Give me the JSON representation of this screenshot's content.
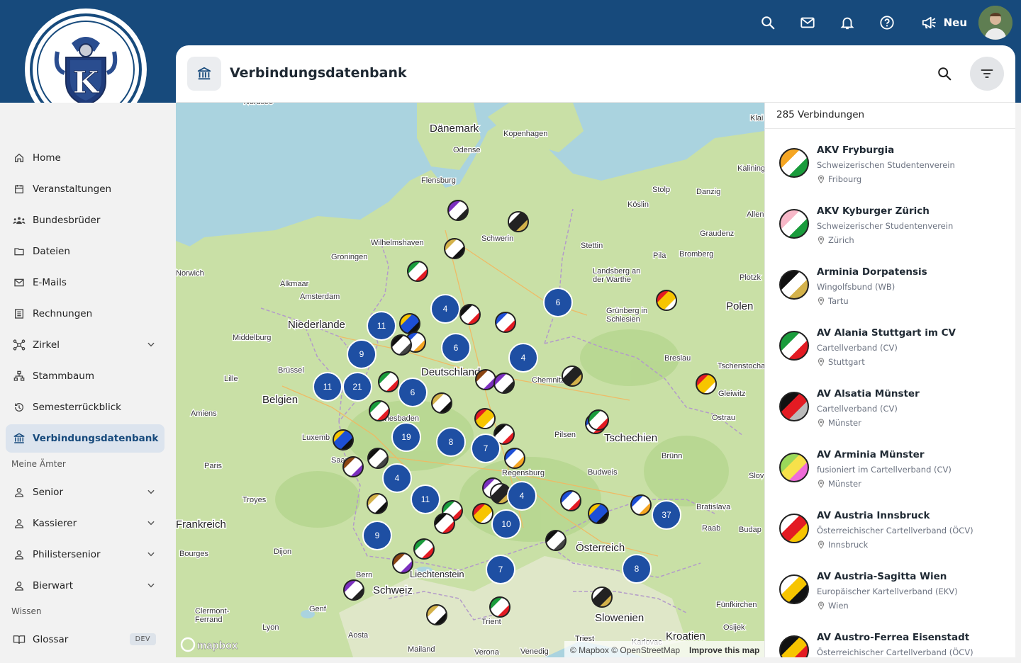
{
  "header": {
    "new_label": "Neu",
    "icons": [
      "search-icon",
      "mail-icon",
      "bell-icon",
      "help-icon",
      "megaphone-icon"
    ]
  },
  "sidebar": {
    "items": [
      {
        "label": "Home",
        "icon": "home-icon"
      },
      {
        "label": "Veranstaltungen",
        "icon": "calendar-icon"
      },
      {
        "label": "Bundesbrüder",
        "icon": "group-icon"
      },
      {
        "label": "Dateien",
        "icon": "folder-icon"
      },
      {
        "label": "E-Mails",
        "icon": "mail-icon"
      },
      {
        "label": "Rechnungen",
        "icon": "receipt-icon"
      },
      {
        "label": "Zirkel",
        "icon": "network-icon"
      },
      {
        "label": "Stammbaum",
        "icon": "tree-icon"
      },
      {
        "label": "Semesterrückblick",
        "icon": "history-icon"
      },
      {
        "label": "Verbindungsdatenbank",
        "icon": "bank-icon",
        "active": true
      }
    ],
    "section_offices": "Meine Ämter",
    "offices": [
      {
        "label": "Senior"
      },
      {
        "label": "Kassierer"
      },
      {
        "label": "Philistersenior"
      },
      {
        "label": "Bierwart"
      }
    ],
    "section_knowledge": "Wissen",
    "knowledge": [
      {
        "label": "Glossar",
        "badge": "DEV"
      }
    ]
  },
  "page": {
    "title": "Verbindungsdatenbank"
  },
  "map": {
    "attribution": "© Mapbox © OpenStreetMap",
    "improve": "Improve this map",
    "mapbox_logo": "mapbox",
    "countries": [
      {
        "name": "Dänemark"
      },
      {
        "name": "Niederlande"
      },
      {
        "name": "Belgien"
      },
      {
        "name": "Deutschland"
      },
      {
        "name": "Tschechien"
      },
      {
        "name": "Polen"
      },
      {
        "name": "Frankreich"
      },
      {
        "name": "Schweiz"
      },
      {
        "name": "Liechtenstein"
      },
      {
        "name": "Österreich"
      },
      {
        "name": "Slowenien"
      },
      {
        "name": "Kroatien"
      }
    ],
    "cities": [
      "Kopenhagen",
      "Odense",
      "Flensburg",
      "Schwerin",
      "Wilhelmshaven",
      "Groningen",
      "Norwich",
      "Alkmaar",
      "Amsterdam",
      "Middelburg",
      "Brüssel",
      "Lille",
      "Amiens",
      "Paris",
      "Troyes",
      "Luxemb",
      "Bourges",
      "Dijon",
      "Clermont-Ferrand",
      "Lyon",
      "Genf",
      "Bern",
      "Aosta",
      "Mailand",
      "Verona",
      "Venedig",
      "Trient",
      "Triest",
      "Stettin",
      "Stolp",
      "Danzig",
      "Köslin",
      "Graudenz",
      "Bromberg",
      "Pila",
      "Landsberg an der Warthe",
      "Grünberg in Schlesien",
      "Breslau",
      "Plotzk",
      "Tschenstocha",
      "Gleiwitz",
      "Ostrau",
      "Chemnitz",
      "Pilsen",
      "Regensburg",
      "Budweis",
      "Brünn",
      "Bratislava",
      "Raab",
      "Budap",
      "Fünfkirchen",
      "Osijek",
      "Karlovac",
      "Kaliningr",
      "Allen",
      "Klai",
      "Slov",
      "Saar",
      "Wiesbaden",
      "Nordsee"
    ],
    "clusters": [
      4,
      6,
      11,
      9,
      6,
      4,
      11,
      21,
      6,
      19,
      8,
      7,
      4,
      11,
      4,
      10,
      9,
      37,
      7,
      8
    ]
  },
  "list": {
    "count": "285 Verbindungen",
    "items": [
      {
        "name": "AKV Fryburgia",
        "sub": "Schweizerischen Studentenverein",
        "loc": "Fribourg",
        "colors": [
          "#1a9c3c",
          "#ffffff",
          "#f5a623"
        ]
      },
      {
        "name": "AKV Kyburger Zürich",
        "sub": "Schweizerischer Studentenverein",
        "loc": "Zürich",
        "colors": [
          "#1a9c3c",
          "#ffffff",
          "#f7b8c8"
        ]
      },
      {
        "name": "Arminia Dorpatensis",
        "sub": "Wingolfsbund (WB)",
        "loc": "Tartu",
        "colors": [
          "#d4b24a",
          "#ffffff",
          "#111111"
        ]
      },
      {
        "name": "AV Alania Stuttgart im CV",
        "sub": "Cartellverband (CV)",
        "loc": "Stuttgart",
        "colors": [
          "#e31b23",
          "#ffffff",
          "#1a9c3c"
        ]
      },
      {
        "name": "AV Alsatia Münster",
        "sub": "Cartellverband (CV)",
        "loc": "Münster",
        "colors": [
          "#bbbbbb",
          "#e31b23",
          "#111111"
        ]
      },
      {
        "name": "AV Arminia Münster",
        "sub": "fusioniert im Cartellverband (CV)",
        "loc": "Münster",
        "colors": [
          "#ef6bd8",
          "#f7e14a",
          "#9ad85a"
        ]
      },
      {
        "name": "AV Austria Innsbruck",
        "sub": "Österreichischer Cartellverband (ÖCV)",
        "loc": "Innsbruck",
        "colors": [
          "#f7c500",
          "#e31b23",
          "#ffffff"
        ]
      },
      {
        "name": "AV Austria-Sagitta Wien",
        "sub": "Europäischer Kartellverband (EKV)",
        "loc": "Wien",
        "colors": [
          "#111111",
          "#f7c500",
          "#ffffff"
        ]
      },
      {
        "name": "AV Austro-Ferrea Eisenstadt",
        "sub": "Österreichischer Cartellverband (ÖCV)",
        "loc": "",
        "colors": [
          "#e31b23",
          "#f7c500",
          "#111111"
        ]
      }
    ]
  }
}
